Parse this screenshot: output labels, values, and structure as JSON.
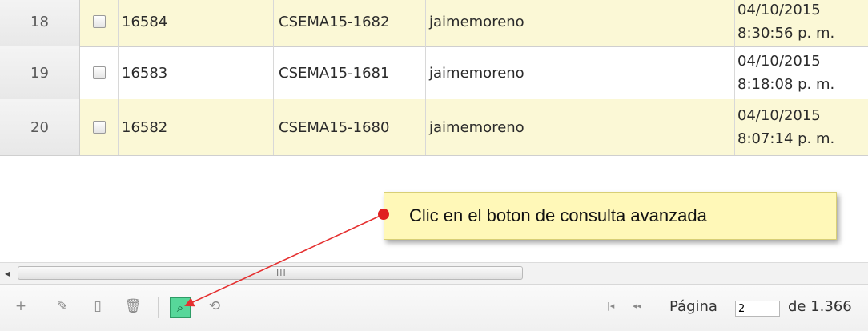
{
  "grid": {
    "rows": [
      {
        "num": "18",
        "id": "16584",
        "code": "CSEMA15-1682",
        "user": "jaimemoreno",
        "date": "04/10/2015",
        "time": "8:30:56 p. m."
      },
      {
        "num": "19",
        "id": "16583",
        "code": "CSEMA15-1681",
        "user": "jaimemoreno",
        "date": "04/10/2015",
        "time": "8:18:08 p. m."
      },
      {
        "num": "20",
        "id": "16582",
        "code": "CSEMA15-1680",
        "user": "jaimemoreno",
        "date": "04/10/2015",
        "time": "8:07:14 p. m."
      }
    ]
  },
  "callout": {
    "text": "Clic en el boton de consulta avanzada"
  },
  "scrollbar": {
    "left_arrow": "◂",
    "grip": "III"
  },
  "toolbar": {
    "add_icon": "+",
    "edit_icon": "✎",
    "view_icon": "▯",
    "delete_icon": "🗑",
    "search_icon": "⌕",
    "refresh_icon": "⟲"
  },
  "pager": {
    "first_icon": "|◂",
    "prev_icon": "◂◂",
    "label": "Página",
    "current_page": "2",
    "of_text": "de 1.366"
  },
  "colors": {
    "highlight": "#fbf8d6",
    "callout_bg": "#fff8b8",
    "arrow": "#e53030",
    "search_button": "#57d79a"
  }
}
